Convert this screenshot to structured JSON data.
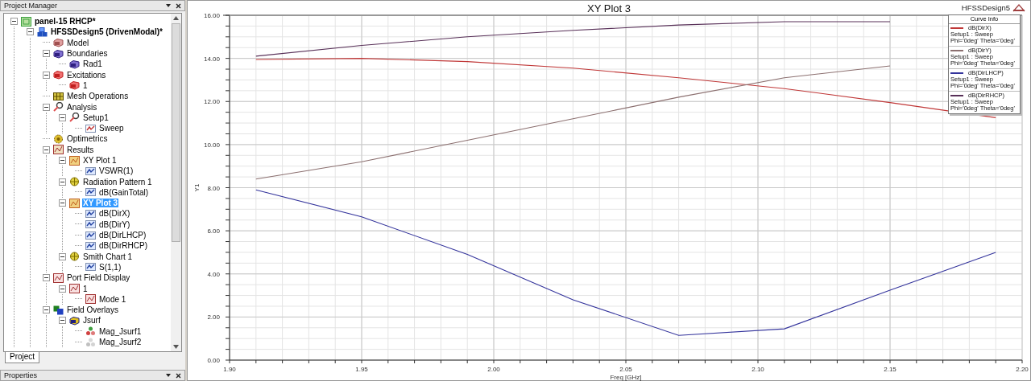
{
  "project_manager": {
    "title": "Project Manager",
    "tree": [
      {
        "label": "panel-15 RHCP*",
        "kind": "project",
        "bold": true,
        "expanded": true,
        "selected": false,
        "children": [
          {
            "label": "HFSSDesign5 (DrivenModal)*",
            "kind": "design",
            "bold": true,
            "expanded": true,
            "selected": false,
            "children": [
              {
                "label": "Model",
                "kind": "model",
                "bold": false,
                "selected": false
              },
              {
                "label": "Boundaries",
                "kind": "boundary",
                "bold": false,
                "expanded": true,
                "selected": false,
                "children": [
                  {
                    "label": "Rad1",
                    "kind": "boundary",
                    "bold": false,
                    "selected": false
                  }
                ]
              },
              {
                "label": "Excitations",
                "kind": "excitation",
                "bold": false,
                "expanded": true,
                "selected": false,
                "children": [
                  {
                    "label": "1",
                    "kind": "excitation",
                    "bold": false,
                    "selected": false
                  }
                ]
              },
              {
                "label": "Mesh Operations",
                "kind": "mesh",
                "bold": false,
                "selected": false
              },
              {
                "label": "Analysis",
                "kind": "analysis",
                "bold": false,
                "expanded": true,
                "selected": false,
                "children": [
                  {
                    "label": "Setup1",
                    "kind": "analysis",
                    "bold": false,
                    "expanded": true,
                    "selected": false,
                    "children": [
                      {
                        "label": "Sweep",
                        "kind": "sweep",
                        "bold": false,
                        "selected": false
                      }
                    ]
                  }
                ]
              },
              {
                "label": "Optimetrics",
                "kind": "optimetrics",
                "bold": false,
                "selected": false
              },
              {
                "label": "Results",
                "kind": "results",
                "bold": false,
                "expanded": true,
                "selected": false,
                "children": [
                  {
                    "label": "XY Plot 1",
                    "kind": "xyplot",
                    "bold": false,
                    "expanded": true,
                    "selected": false,
                    "children": [
                      {
                        "label": "VSWR(1)",
                        "kind": "trace",
                        "bold": false,
                        "selected": false
                      }
                    ]
                  },
                  {
                    "label": "Radiation Pattern 1",
                    "kind": "radiation",
                    "bold": false,
                    "expanded": true,
                    "selected": false,
                    "children": [
                      {
                        "label": "dB(GainTotal)",
                        "kind": "trace",
                        "bold": false,
                        "selected": false
                      }
                    ]
                  },
                  {
                    "label": "XY Plot 3",
                    "kind": "xyplot",
                    "bold": false,
                    "expanded": true,
                    "selected": true,
                    "children": [
                      {
                        "label": "dB(DirX)",
                        "kind": "trace",
                        "bold": false,
                        "selected": false
                      },
                      {
                        "label": "dB(DirY)",
                        "kind": "trace",
                        "bold": false,
                        "selected": false
                      },
                      {
                        "label": "dB(DirLHCP)",
                        "kind": "trace",
                        "bold": false,
                        "selected": false
                      },
                      {
                        "label": "dB(DirRHCP)",
                        "kind": "trace",
                        "bold": false,
                        "selected": false
                      }
                    ]
                  },
                  {
                    "label": "Smith Chart 1",
                    "kind": "radiation",
                    "bold": false,
                    "expanded": true,
                    "selected": false,
                    "children": [
                      {
                        "label": "S(1,1)",
                        "kind": "trace",
                        "bold": false,
                        "selected": false
                      }
                    ]
                  }
                ]
              },
              {
                "label": "Port Field Display",
                "kind": "portfield",
                "bold": false,
                "expanded": true,
                "selected": false,
                "children": [
                  {
                    "label": "1",
                    "kind": "portfield",
                    "bold": false,
                    "expanded": true,
                    "selected": false,
                    "children": [
                      {
                        "label": "Mode 1",
                        "kind": "portfield",
                        "bold": false,
                        "selected": false
                      }
                    ]
                  }
                ]
              },
              {
                "label": "Field Overlays",
                "kind": "overlays",
                "bold": false,
                "expanded": true,
                "selected": false,
                "children": [
                  {
                    "label": "Jsurf",
                    "kind": "jsurf",
                    "bold": false,
                    "expanded": true,
                    "selected": false,
                    "children": [
                      {
                        "label": "Mag_Jsurf1",
                        "kind": "plot3d",
                        "bold": false,
                        "selected": false
                      },
                      {
                        "label": "Mag_Jsurf2",
                        "kind": "plot3d_off",
                        "bold": false,
                        "selected": false
                      }
                    ]
                  }
                ]
              }
            ]
          }
        ]
      }
    ],
    "tabs": [
      {
        "label": "Project",
        "selected": true
      }
    ]
  },
  "properties": {
    "title": "Properties"
  },
  "plot": {
    "design_name": "HFSSDesign5",
    "chart_data": {
      "type": "line",
      "title": "XY Plot 3",
      "xlabel": "Freq [GHz]",
      "ylabel": "Y1",
      "x": [
        1.91,
        1.95,
        1.99,
        2.03,
        2.07,
        2.11,
        2.15,
        2.19
      ],
      "series": [
        {
          "name": "dB(DirX)",
          "color": "#c03838",
          "values": [
            13.95,
            14.0,
            13.85,
            13.55,
            13.1,
            12.6,
            11.95,
            11.25
          ]
        },
        {
          "name": "dB(DirY)",
          "color": "#8c7070",
          "values": [
            8.4,
            9.2,
            10.2,
            11.2,
            12.2,
            13.1,
            13.65,
            null
          ]
        },
        {
          "name": "dB(DirLHCP)",
          "color": "#34349c",
          "values": [
            7.9,
            6.65,
            4.9,
            2.8,
            1.15,
            1.45,
            3.25,
            5.0
          ]
        },
        {
          "name": "dB(DirRHCP)",
          "color": "#583058",
          "values": [
            14.1,
            14.6,
            15.0,
            15.3,
            15.55,
            15.7,
            15.7,
            null
          ]
        }
      ],
      "grid": true,
      "xlim": [
        1.9,
        2.2
      ],
      "ylim": [
        0,
        16
      ],
      "xticks": [
        {
          "value": 1.9,
          "label": "1.90"
        },
        {
          "value": 1.95,
          "label": "1.95"
        },
        {
          "value": 2.0,
          "label": "2.00"
        },
        {
          "value": 2.05,
          "label": "2.05"
        },
        {
          "value": 2.1,
          "label": "2.10"
        },
        {
          "value": 2.15,
          "label": "2.15"
        },
        {
          "value": 2.2,
          "label": "2.20"
        }
      ],
      "yticks": [
        {
          "value": 0,
          "label": "0.00"
        },
        {
          "value": 2,
          "label": "2.00"
        },
        {
          "value": 4,
          "label": "4.00"
        },
        {
          "value": 6,
          "label": "6.00"
        },
        {
          "value": 8,
          "label": "8.00"
        },
        {
          "value": 10,
          "label": "10.00"
        },
        {
          "value": 12,
          "label": "12.00"
        },
        {
          "value": 14,
          "label": "14.00"
        },
        {
          "value": 16,
          "label": "16.00"
        }
      ]
    },
    "legend": {
      "title": "Curve Info",
      "entries": [
        {
          "setup": "Setup1 : Sweep",
          "variation": "Phi='0deg' Theta='0deg'"
        },
        {
          "setup": "Setup1 : Sweep",
          "variation": "Phi='0deg' Theta='0deg'"
        },
        {
          "setup": "Setup1 : Sweep",
          "variation": "Phi='0deg' Theta='0deg'"
        },
        {
          "setup": "Setup1 : Sweep",
          "variation": "Phi='0deg' Theta='0deg'"
        }
      ]
    }
  }
}
